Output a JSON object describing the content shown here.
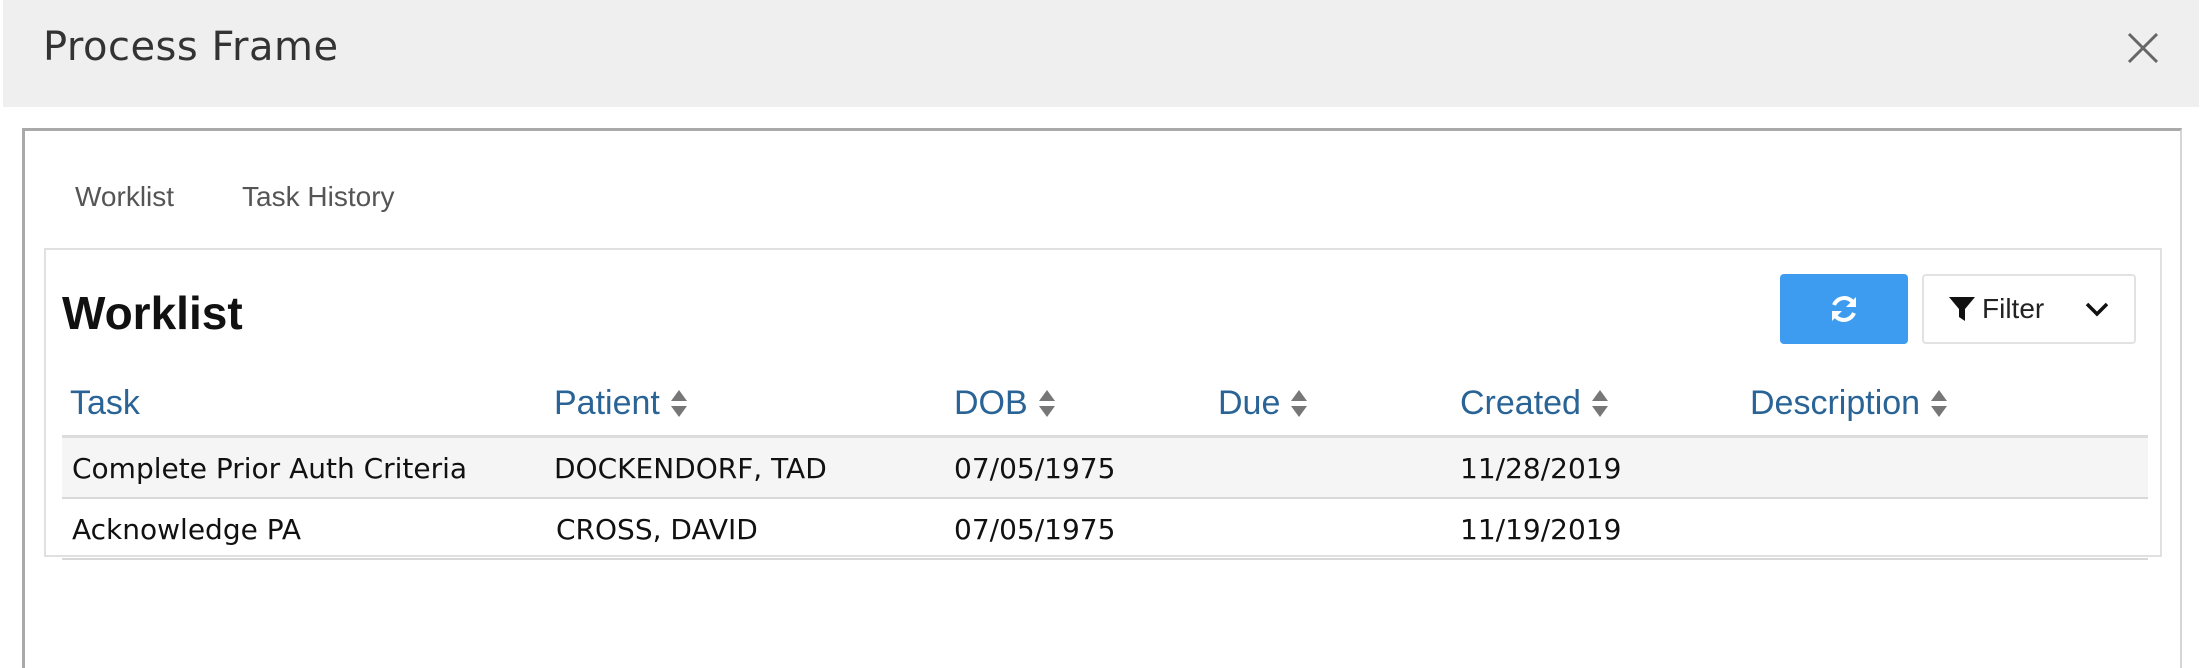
{
  "window": {
    "title": "Process Frame",
    "close_icon": "close-icon"
  },
  "tabs": [
    {
      "label": "Worklist"
    },
    {
      "label": "Task History"
    }
  ],
  "panel": {
    "title": "Worklist",
    "refresh_icon": "refresh-icon",
    "filter_label": "Filter",
    "filter_icon": "funnel-icon",
    "dropdown_icon": "chevron-down-icon",
    "accent_color": "#3d9cf0",
    "header_color": "#2a6496"
  },
  "table": {
    "columns": [
      {
        "label": "Task",
        "sortable": false
      },
      {
        "label": "Patient",
        "sortable": true
      },
      {
        "label": "DOB",
        "sortable": true
      },
      {
        "label": "Due",
        "sortable": true
      },
      {
        "label": "Created",
        "sortable": true
      },
      {
        "label": "Description",
        "sortable": true
      }
    ],
    "rows": [
      {
        "task": "Complete Prior Auth Criteria",
        "patient": "DOCKENDORF, TAD",
        "dob": "07/05/1975",
        "due": "",
        "created": "11/28/2019",
        "description": ""
      },
      {
        "task": "Acknowledge PA",
        "patient": "CROSS, DAVID",
        "dob": "07/05/1975",
        "due": "",
        "created": "11/19/2019",
        "description": ""
      }
    ]
  }
}
